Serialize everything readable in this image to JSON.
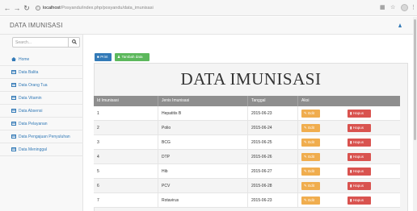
{
  "browser": {
    "url_host": "localhost",
    "url_path": "/Posyandu/index.php/posyandu/data_imunisasi"
  },
  "navbar": {
    "brand": "DATA IMUNISASI"
  },
  "sidebar": {
    "search_placeholder": "Search...",
    "items": [
      {
        "label": "Home",
        "icon": "home-icon"
      },
      {
        "label": "Data Balita",
        "icon": "table-icon"
      },
      {
        "label": "Data Orang Tua",
        "icon": "table-icon"
      },
      {
        "label": "Data Vitamin",
        "icon": "table-icon"
      },
      {
        "label": "Data Absensi",
        "icon": "table-icon"
      },
      {
        "label": "Data Pelayanan",
        "icon": "table-icon"
      },
      {
        "label": "Data Pengajuan Penyuluhan",
        "icon": "table-icon"
      },
      {
        "label": "Data Meninggal",
        "icon": "table-icon"
      }
    ]
  },
  "toolbar": {
    "print_label": "Print",
    "add_label": "Tambah data"
  },
  "main": {
    "title": "DATA IMUNISASI"
  },
  "table": {
    "headers": [
      "Id Imunisasi",
      "Jenis Imunisasi",
      "Tanggal",
      "Aksi"
    ],
    "edit_label": "Edit",
    "delete_label": "Hapus",
    "rows": [
      {
        "id": "1",
        "jenis": "Hepatitis B",
        "tanggal": "2015-06-23"
      },
      {
        "id": "2",
        "jenis": "Polio",
        "tanggal": "2015-06-24"
      },
      {
        "id": "3",
        "jenis": "BCG",
        "tanggal": "2015-06-25"
      },
      {
        "id": "4",
        "jenis": "DTP",
        "tanggal": "2015-06-26"
      },
      {
        "id": "5",
        "jenis": "Hib",
        "tanggal": "2015-06-27"
      },
      {
        "id": "6",
        "jenis": "PCV",
        "tanggal": "2015-06-28"
      },
      {
        "id": "7",
        "jenis": "Rotavirus",
        "tanggal": "2015-06-23"
      }
    ]
  },
  "colors": {
    "primary": "#337ab7",
    "success": "#5cb85c",
    "warning": "#f0ad4e",
    "danger": "#d9534f",
    "table_header": "#8e8e8e"
  }
}
